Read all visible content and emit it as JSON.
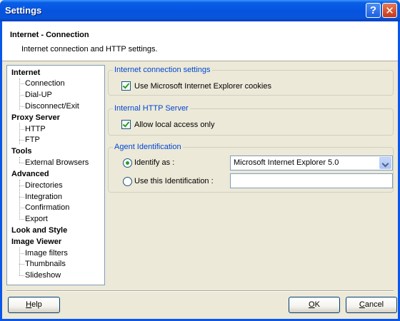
{
  "window": {
    "title": "Settings",
    "help_glyph": "?",
    "close_glyph": "✕"
  },
  "header": {
    "title": "Internet - Connection",
    "subtitle": "Internet connection and HTTP settings."
  },
  "nav": {
    "categories": [
      {
        "label": "Internet",
        "items": [
          "Connection",
          "Dial-UP",
          "Disconnect/Exit"
        ]
      },
      {
        "label": "Proxy Server",
        "items": [
          "HTTP",
          "FTP"
        ]
      },
      {
        "label": "Tools",
        "items": [
          "External Browsers"
        ]
      },
      {
        "label": "Advanced",
        "items": [
          "Directories",
          "Integration",
          "Confirmation",
          "Export"
        ]
      },
      {
        "label": "Look and Style",
        "items": []
      },
      {
        "label": "Image Viewer",
        "items": [
          "Image filters",
          "Thumbnails",
          "Slideshow"
        ]
      }
    ]
  },
  "groups": {
    "connection": {
      "legend": "Internet connection settings",
      "ie_cookies_label": "Use Microsoft Internet Explorer cookies",
      "ie_cookies_checked": true
    },
    "http_server": {
      "legend": "Internal HTTP Server",
      "local_access_label": "Allow local access only",
      "local_access_checked": true
    },
    "agent": {
      "legend": "Agent Identification",
      "identify_as_label": "Identify as :",
      "identify_as_selected": true,
      "identify_as_value": "Microsoft Internet Explorer 5.0",
      "custom_label": "Use this Identification :",
      "custom_value": ""
    }
  },
  "buttons": {
    "help": {
      "prefix": "",
      "accel": "H",
      "rest": "elp"
    },
    "ok": {
      "prefix": "",
      "accel": "O",
      "rest": "K"
    },
    "cancel": {
      "prefix": "",
      "accel": "C",
      "rest": "ancel"
    }
  },
  "colors": {
    "title_bar": "#0553e0",
    "group_legend": "#0046d5",
    "check_mark": "#21a121"
  }
}
